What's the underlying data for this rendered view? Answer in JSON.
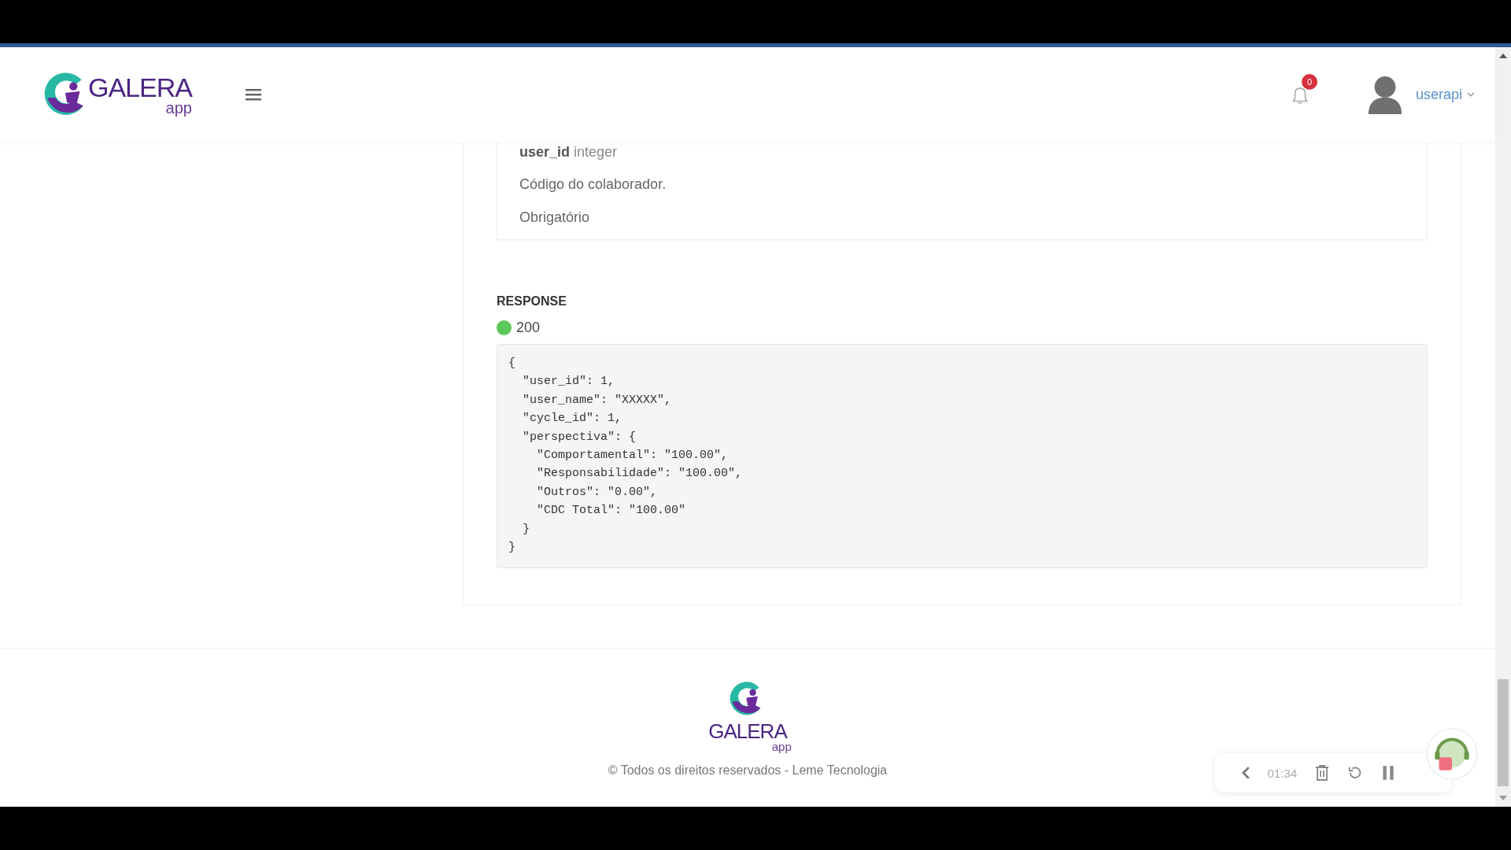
{
  "header": {
    "logo": {
      "name": "GALERA",
      "suffix": "app"
    },
    "notifications": {
      "count": "0"
    },
    "user": {
      "name": "userapi"
    }
  },
  "parameter": {
    "name": "user_id",
    "type": "integer",
    "description": "Código do colaborador.",
    "requirement": "Obrigatório"
  },
  "response": {
    "title": "RESPONSE",
    "status": {
      "code": "200",
      "color": "#5cc85a"
    },
    "body": [
      "{",
      "  \"user_id\": 1,",
      "  \"user_name\": \"XXXXX\",",
      "  \"cycle_id\": 1,",
      "  \"perspectiva\": {",
      "    \"Comportamental\": \"100.00\",",
      "    \"Responsabilidade\": \"100.00\",",
      "    \"Outros\": \"0.00\",",
      "    \"CDC Total\": \"100.00\"",
      "  }",
      "}"
    ]
  },
  "footer": {
    "logo": {
      "name": "GALERA",
      "suffix": "app"
    },
    "copyright": "© Todos os direitos reservados - Leme Tecnologia"
  },
  "recorder": {
    "time": "01:34"
  }
}
